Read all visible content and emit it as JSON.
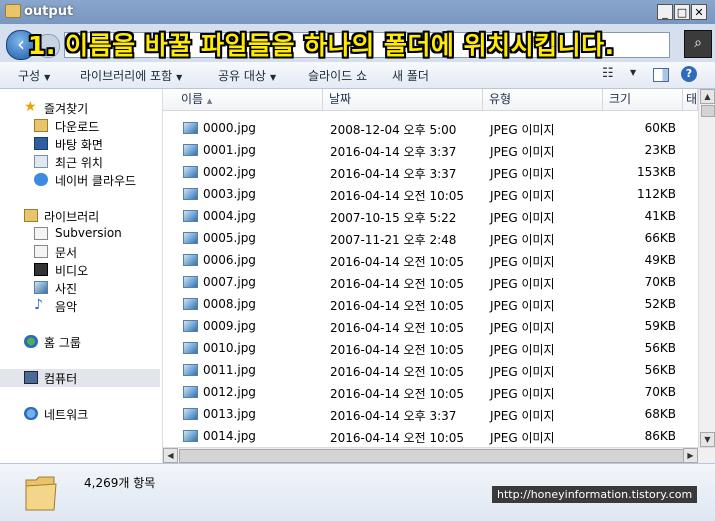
{
  "window": {
    "title": "output"
  },
  "banner": "1. 이름을 바꿀 파일들을 하나의 폴더에 위치시킵니다.",
  "toolbar": {
    "organize": "구성",
    "include_in_library": "라이브러리에 포함",
    "share_with": "공유 대상",
    "slideshow": "슬라이드 쇼",
    "new_folder": "새 폴더"
  },
  "nav": {
    "favorites": "즐겨찾기",
    "downloads": "다운로드",
    "desktop": "바탕 화면",
    "recent": "최근 위치",
    "naver_cloud": "네이버 클라우드",
    "libraries": "라이브러리",
    "subversion": "Subversion",
    "documents": "문서",
    "videos": "비디오",
    "pictures": "사진",
    "music": "음악",
    "homegroup": "홈 그룹",
    "computer": "컴퓨터",
    "network": "네트워크"
  },
  "columns": {
    "name": "이름",
    "date": "날짜",
    "type": "유형",
    "size": "크기",
    "extra": "태"
  },
  "files": [
    {
      "name": "0000.jpg",
      "date": "2008-12-04 오후 5:00",
      "type": "JPEG 이미지",
      "size": "60KB"
    },
    {
      "name": "0001.jpg",
      "date": "2016-04-14 오후 3:37",
      "type": "JPEG 이미지",
      "size": "23KB"
    },
    {
      "name": "0002.jpg",
      "date": "2016-04-14 오후 3:37",
      "type": "JPEG 이미지",
      "size": "153KB"
    },
    {
      "name": "0003.jpg",
      "date": "2016-04-14 오전 10:05",
      "type": "JPEG 이미지",
      "size": "112KB"
    },
    {
      "name": "0004.jpg",
      "date": "2007-10-15 오후 5:22",
      "type": "JPEG 이미지",
      "size": "41KB"
    },
    {
      "name": "0005.jpg",
      "date": "2007-11-21 오후 2:48",
      "type": "JPEG 이미지",
      "size": "66KB"
    },
    {
      "name": "0006.jpg",
      "date": "2016-04-14 오전 10:05",
      "type": "JPEG 이미지",
      "size": "49KB"
    },
    {
      "name": "0007.jpg",
      "date": "2016-04-14 오전 10:05",
      "type": "JPEG 이미지",
      "size": "70KB"
    },
    {
      "name": "0008.jpg",
      "date": "2016-04-14 오전 10:05",
      "type": "JPEG 이미지",
      "size": "52KB"
    },
    {
      "name": "0009.jpg",
      "date": "2016-04-14 오전 10:05",
      "type": "JPEG 이미지",
      "size": "59KB"
    },
    {
      "name": "0010.jpg",
      "date": "2016-04-14 오전 10:05",
      "type": "JPEG 이미지",
      "size": "56KB"
    },
    {
      "name": "0011.jpg",
      "date": "2016-04-14 오전 10:05",
      "type": "JPEG 이미지",
      "size": "56KB"
    },
    {
      "name": "0012.jpg",
      "date": "2016-04-14 오전 10:05",
      "type": "JPEG 이미지",
      "size": "70KB"
    },
    {
      "name": "0013.jpg",
      "date": "2016-04-14 오후 3:37",
      "type": "JPEG 이미지",
      "size": "68KB"
    },
    {
      "name": "0014.jpg",
      "date": "2016-04-14 오전 10:05",
      "type": "JPEG 이미지",
      "size": "86KB"
    }
  ],
  "status": {
    "item_count": "4,269개 항목"
  },
  "watermark": "http://honeyinformation.tistory.com"
}
